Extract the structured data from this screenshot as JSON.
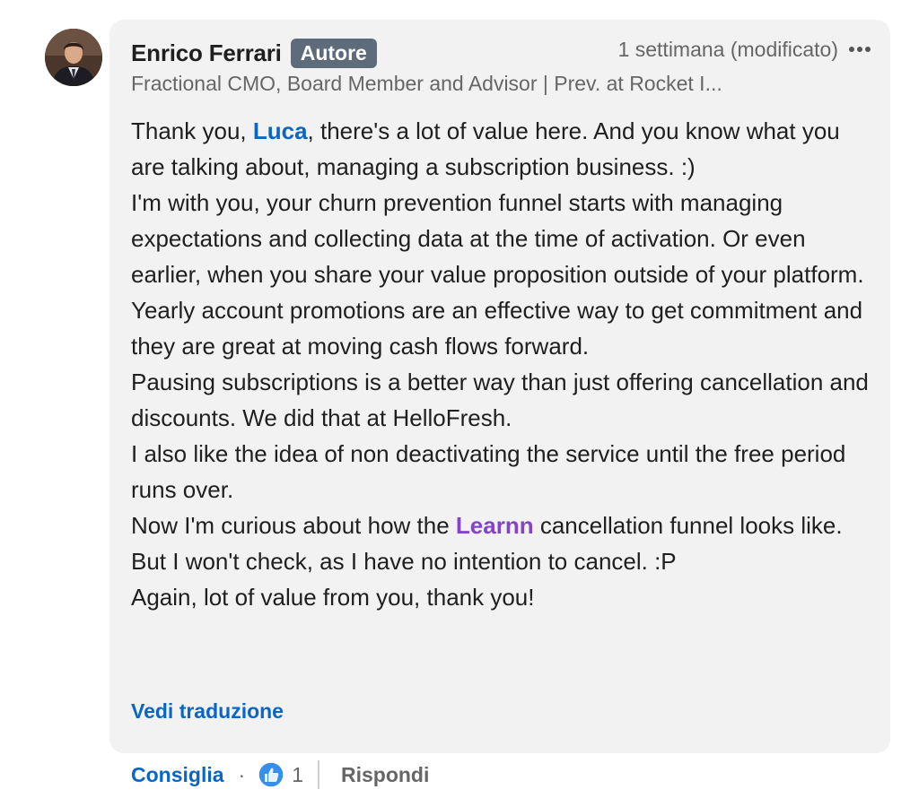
{
  "author": {
    "name": "Enrico Ferrari",
    "badge": "Autore",
    "headline": "Fractional CMO, Board Member and Advisor | Prev. at Rocket I..."
  },
  "meta": {
    "timestamp": "1 settimana (modificato)",
    "more_icon": "ellipsis-icon"
  },
  "comment": {
    "p1_before": "Thank you, ",
    "p1_mention": "Luca",
    "p1_after": ", there's a lot of value here. And you know what you are talking about, managing a subscription business. :)",
    "p2": "I'm with you, your churn prevention funnel starts with managing expectations and collecting data at the time of activation. Or even earlier, when you share your value proposition outside of your platform.",
    "p3": "Yearly account promotions are an effective way to get commitment and they are great at moving cash flows forward.",
    "p4": "Pausing subscriptions is a better way than just offering cancellation and discounts. We did that at HelloFresh.",
    "p5": "I also like the idea of non deactivating the service until the free period runs over.",
    "p6_before": "Now I'm curious about how the ",
    "p6_mention": "Learnn",
    "p6_after": " cancellation funnel looks like. But I won't check, as I have no intention to cancel. :P",
    "p7": "Again, lot of value from you, thank you!"
  },
  "see_translation": "Vedi traduzione",
  "actions": {
    "like_label": "Consiglia",
    "separator": "·",
    "reaction_icon": "thumbs-up-icon",
    "reaction_count": "1",
    "reply_label": "Rispondi"
  },
  "colors": {
    "link_blue": "#0a66c2",
    "company_purple": "#8344cc",
    "bubble_bg": "#f2f2f2",
    "badge_bg": "#5e6b7a"
  }
}
